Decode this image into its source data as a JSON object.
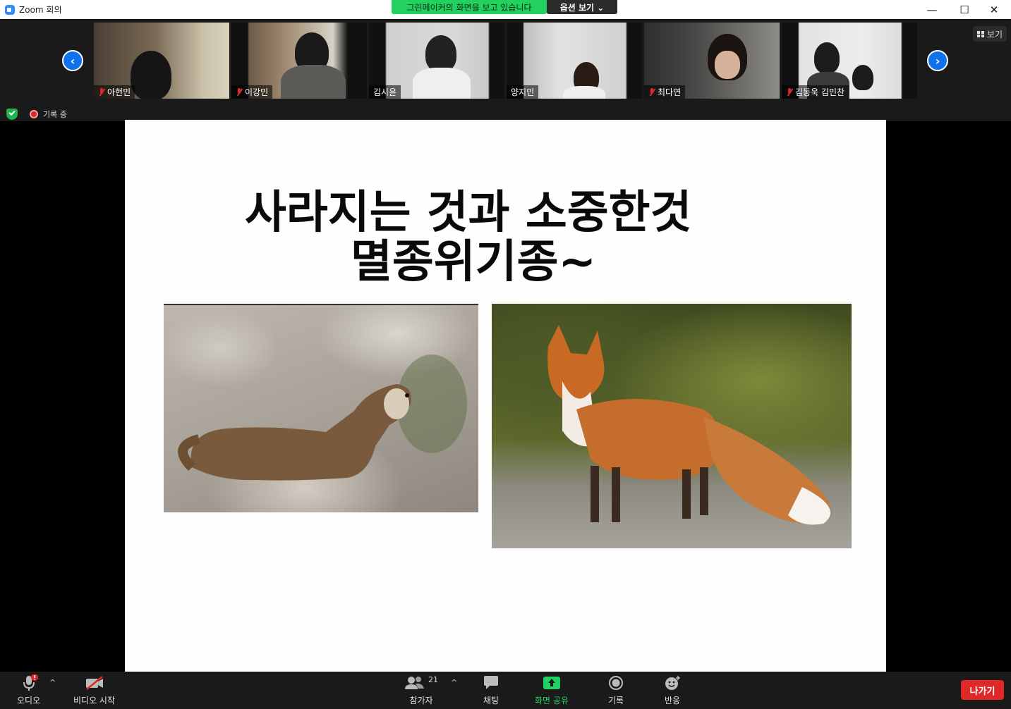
{
  "window": {
    "title": "Zoom 회의",
    "minimize": "—",
    "maximize": "☐",
    "close": "✕"
  },
  "banner": {
    "viewing_text": "그린메이커의 화면을 보고 있습니다",
    "options_label": "옵션 보기 ⌄"
  },
  "gallery": {
    "prev_arrow": "‹",
    "next_arrow": "›",
    "view_label": "보기",
    "participants": [
      {
        "name": "아현민",
        "muted": true
      },
      {
        "name": "이강민",
        "muted": true
      },
      {
        "name": "김시윤",
        "muted": false
      },
      {
        "name": "양지민",
        "muted": false
      },
      {
        "name": "최다연",
        "muted": true
      },
      {
        "name": "김동욱 김민찬",
        "muted": true
      }
    ]
  },
  "status": {
    "recording_label": "기록 중"
  },
  "slide": {
    "title_line1": "사라지는 것과 소중한것",
    "title_line2": "멸종위기종~"
  },
  "toolbar": {
    "audio_label": "오디오",
    "video_label": "비디오 시작",
    "participants_label": "참가자",
    "participants_count": "21",
    "chat_label": "채팅",
    "share_label": "화면 공유",
    "record_label": "기록",
    "reactions_label": "반응",
    "leave_label": "나가기",
    "caret": "^"
  },
  "colors": {
    "accent": "#0e72ed",
    "share_green": "#23d160",
    "leave_red": "#e02828"
  }
}
